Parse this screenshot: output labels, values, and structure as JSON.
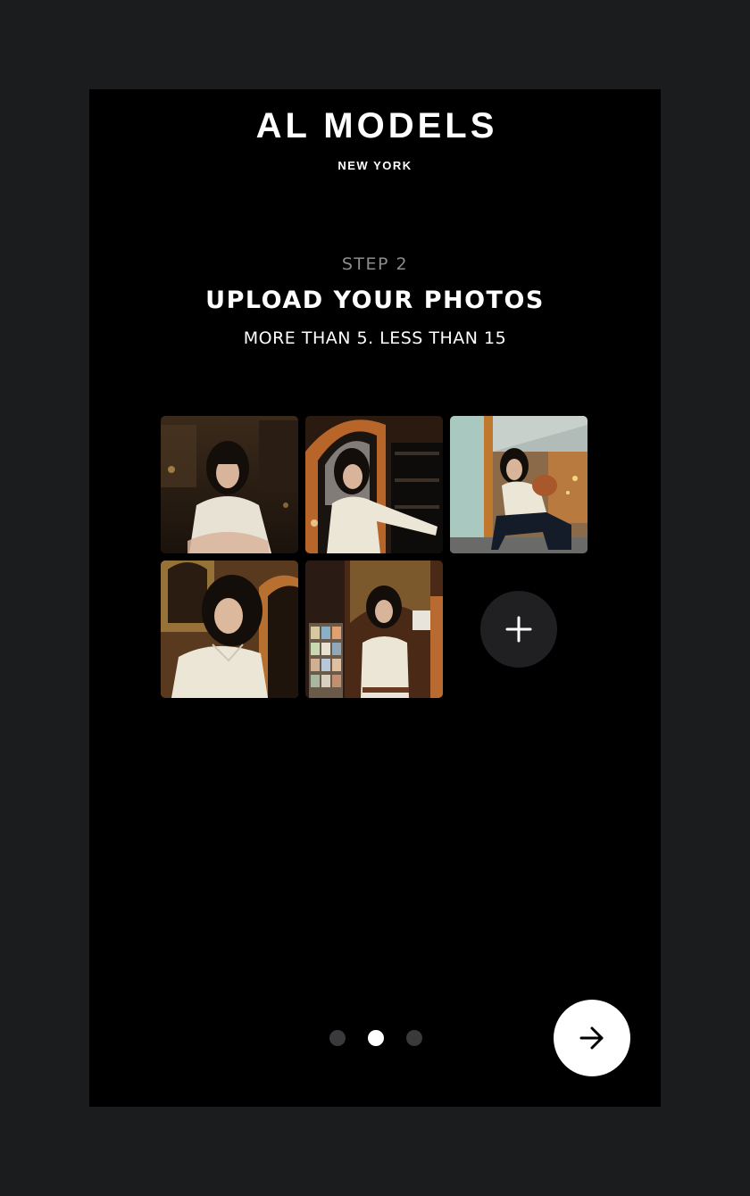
{
  "brand": {
    "name": "AL MODELS",
    "city": "NEW YORK"
  },
  "step": {
    "label": "STEP 2",
    "title": "UPLOAD YOUR PHOTOS",
    "subtitle": "MORE THAN 5. LESS THAN 15"
  },
  "photos": [
    {
      "subject": "woman in cream knit polo, arms crossed, dark cafe interior"
    },
    {
      "subject": "woman in cream knit polo beside arched window and shelves"
    },
    {
      "subject": "woman crouching with brown bag in glass-roofed arcade"
    },
    {
      "subject": "close-up of woman in cream knit polo, golden interior"
    },
    {
      "subject": "woman standing by postcard rack in shop"
    }
  ],
  "add_photo": {
    "icon": "plus-icon"
  },
  "pagination": {
    "total": 3,
    "current": 2
  },
  "next_button": {
    "icon": "arrow-right-icon"
  },
  "colors": {
    "outer_background": "#1b1c1e",
    "screen_background": "#000000",
    "text_primary": "#ffffff",
    "text_muted": "#8c8c8c",
    "add_button": "#202022",
    "dot_inactive": "#3a3a3c",
    "dot_active": "#ffffff",
    "next_button": "#ffffff"
  }
}
